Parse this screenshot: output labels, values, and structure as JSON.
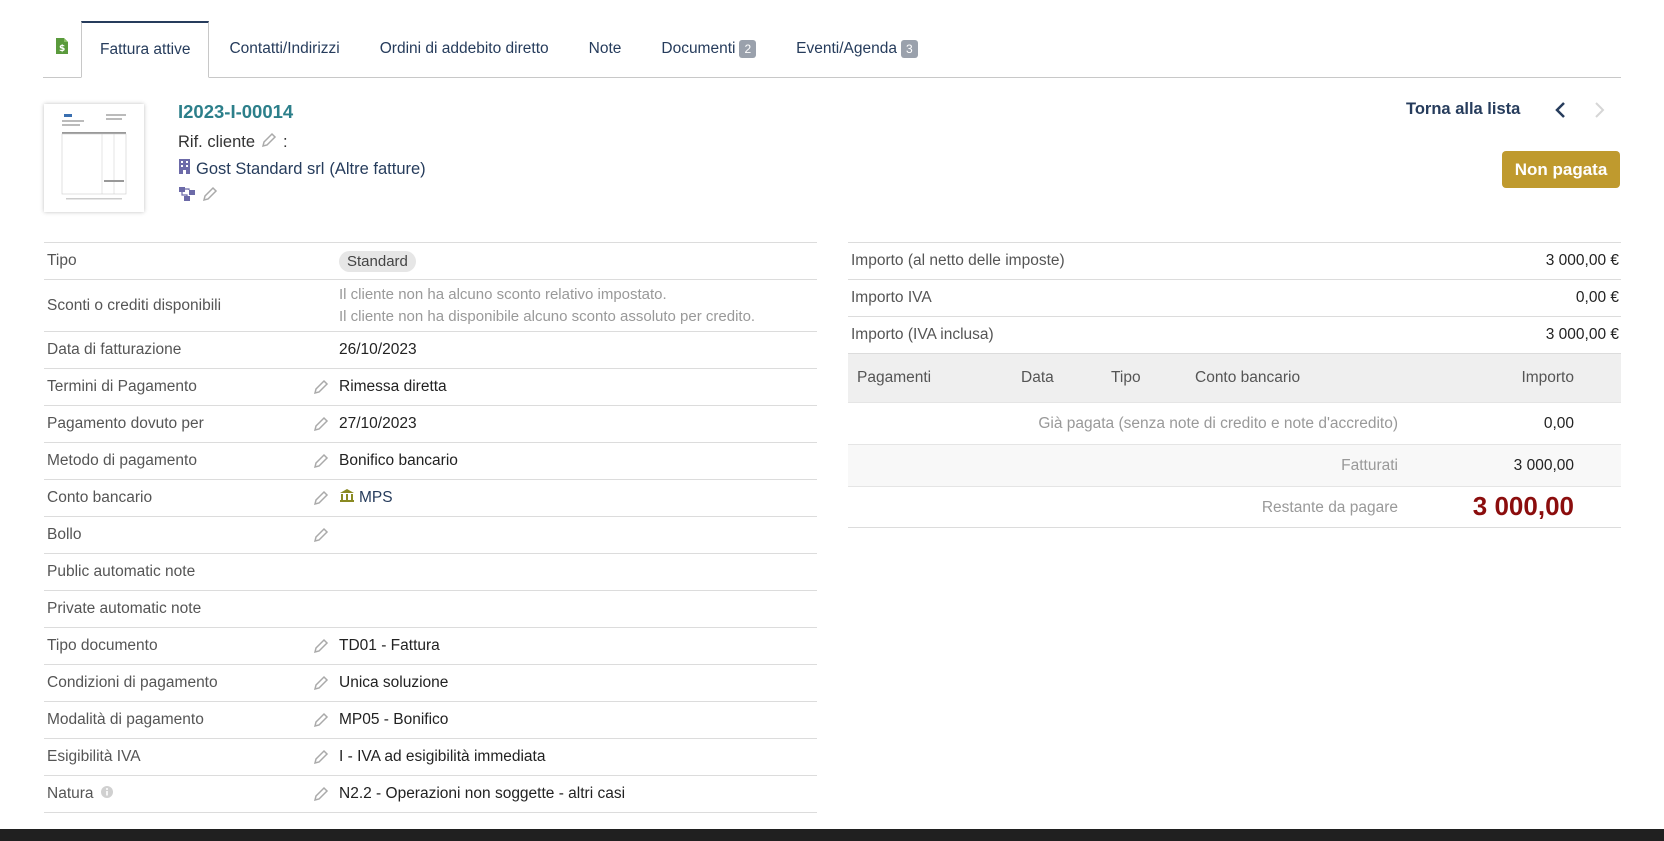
{
  "tabs": [
    {
      "label": "Fattura attive",
      "active": true,
      "count": ""
    },
    {
      "label": "Contatti/Indirizzi",
      "active": false,
      "count": ""
    },
    {
      "label": "Ordini di addebito diretto",
      "active": false,
      "count": ""
    },
    {
      "label": "Note",
      "active": false,
      "count": ""
    },
    {
      "label": "Documenti",
      "active": false,
      "count": "2"
    },
    {
      "label": "Eventi/Agenda",
      "active": false,
      "count": "3"
    }
  ],
  "header": {
    "ref": "I2023-I-00014",
    "rif_cliente": "Rif. cliente",
    "rif_colon": ":",
    "thirdparty_name": "Gost Standard srl",
    "thirdparty_sub": "(Altre fatture)",
    "back_label": "Torna alla lista",
    "status": "Non pagata"
  },
  "fields": [
    {
      "label": "Tipo",
      "value": "Standard",
      "editable": false
    },
    {
      "label": "Sconti o crediti disponibili",
      "value_lines": [
        "Il cliente non ha alcuno sconto relativo impostato.",
        "Il cliente non ha disponibile alcuno sconto assoluto per credito."
      ],
      "editable": false
    },
    {
      "label": "Data di fatturazione",
      "value": "26/10/2023",
      "editable": false
    },
    {
      "label": "Termini di Pagamento",
      "value": "Rimessa diretta",
      "editable": true
    },
    {
      "label": "Pagamento dovuto per",
      "value": "27/10/2023",
      "editable": true
    },
    {
      "label": "Metodo di pagamento",
      "value": "Bonifico bancario",
      "editable": true
    },
    {
      "label": "Conto bancario",
      "value": "MPS",
      "editable": true
    },
    {
      "label": "Bollo",
      "value": "",
      "editable": true
    },
    {
      "label": "Public automatic note",
      "value": "",
      "editable": false
    },
    {
      "label": "Private automatic note",
      "value": "",
      "editable": false
    },
    {
      "label": "Tipo documento",
      "value": "TD01 - Fattura",
      "editable": true
    },
    {
      "label": "Condizioni di pagamento",
      "value": "Unica soluzione",
      "editable": true
    },
    {
      "label": "Modalità di pagamento",
      "value": "MP05 - Bonifico",
      "editable": true
    },
    {
      "label": "Esigibilità IVA",
      "value": "I - IVA ad esigibilità immediata",
      "editable": true
    },
    {
      "label": "Natura",
      "value": "N2.2 - Operazioni non soggette - altri casi",
      "editable": true
    }
  ],
  "amounts": [
    {
      "label": "Importo (al netto delle imposte)",
      "value": "3 000,00 €"
    },
    {
      "label": "Importo IVA",
      "value": "0,00 €"
    },
    {
      "label": "Importo (IVA inclusa)",
      "value": "3 000,00 €"
    }
  ],
  "payments": {
    "headers": {
      "pagamenti": "Pagamenti",
      "data": "Data",
      "tipo": "Tipo",
      "conto": "Conto bancario",
      "importo": "Importo"
    },
    "paid_label": "Già pagata (senza note di credito e note d'accredito)",
    "paid_value": "0,00",
    "billed_label": "Fatturati",
    "billed_value": "3 000,00",
    "remaining_label": "Restante da pagare",
    "remaining_value": "3 000,00"
  },
  "colors": {
    "accent": "#263c5c",
    "ref": "#2c7f8a",
    "status_bg": "#bf9a2e",
    "remaining": "#8b0d0d"
  }
}
